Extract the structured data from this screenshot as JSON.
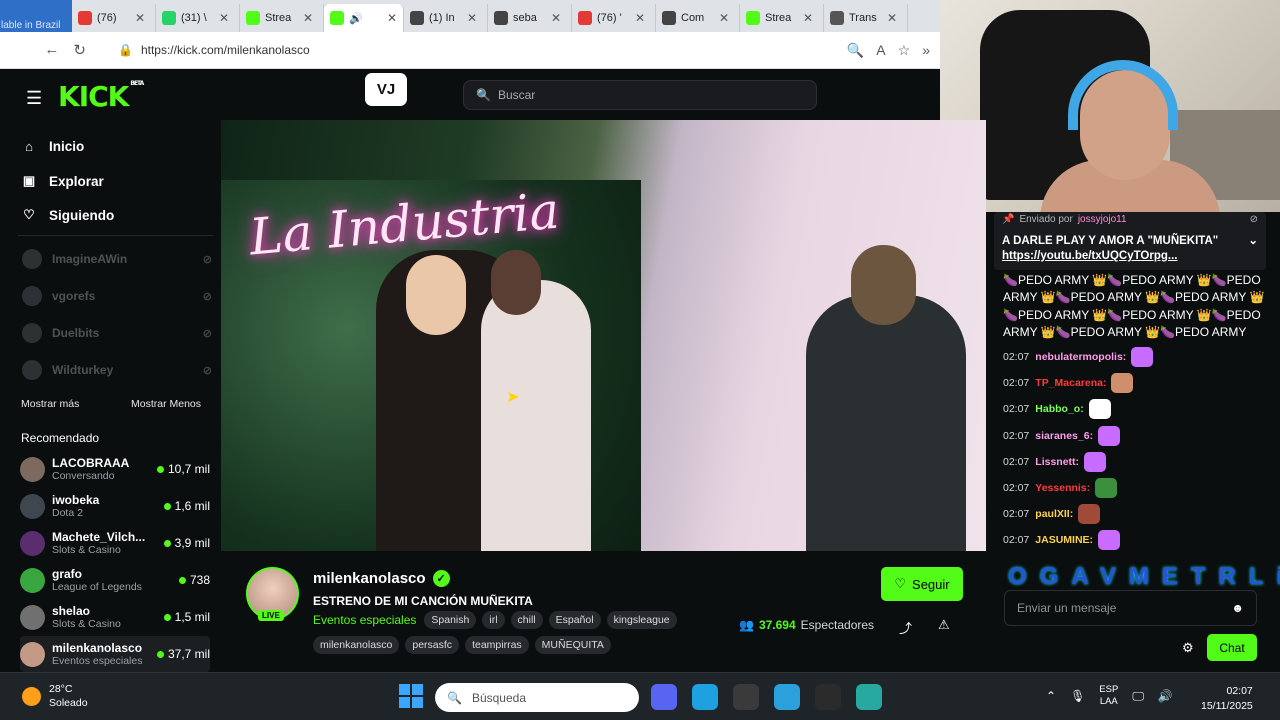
{
  "browser": {
    "lead_text": "lable in Brazil",
    "tabs": [
      {
        "label": "(76) ",
        "color": "#e53935"
      },
      {
        "label": "(31) \\",
        "color": "#25d366"
      },
      {
        "label": "Strea",
        "color": "#53fc18"
      },
      {
        "label": "",
        "color": "#53fc18",
        "active": true
      },
      {
        "label": "(1) In",
        "color": "#444444"
      },
      {
        "label": "seba",
        "color": "#444444"
      },
      {
        "label": "(76) '",
        "color": "#e53935"
      },
      {
        "label": "Com",
        "color": "#444444"
      },
      {
        "label": "Strea",
        "color": "#53fc18"
      },
      {
        "label": "Trans",
        "color": "#555555"
      }
    ],
    "url": "https://kick.com/milenkanolasco"
  },
  "header": {
    "logo": "KICK",
    "logo_beta": "BETA",
    "vj_label": "VJ",
    "search_placeholder": "Buscar"
  },
  "sidebar": {
    "nav": [
      {
        "label": "Inicio",
        "icon": "home-icon"
      },
      {
        "label": "Explorar",
        "icon": "compass-icon"
      },
      {
        "label": "Siguiendo",
        "icon": "heart-icon"
      }
    ],
    "followed": [
      "ImagineAWin",
      "vgorefs",
      "Duelbits",
      "Wildturkey"
    ],
    "show_more": "Mostrar más",
    "show_less": "Mostrar Menos",
    "recommended_title": "Recomendado",
    "recommended": [
      {
        "name": "LACOBRAAA",
        "category": "Conversando",
        "viewers": "10,7 mil",
        "color": "#7c6a5e"
      },
      {
        "name": "iwobeka",
        "category": "Dota 2",
        "viewers": "1,6 mil",
        "color": "#3e4650"
      },
      {
        "name": "Machete_Vilch...",
        "category": "Slots & Casino",
        "viewers": "3,9 mil",
        "color": "#5a2d6e"
      },
      {
        "name": "grafo",
        "category": "League of Legends",
        "viewers": "738",
        "color": "#3aa640"
      },
      {
        "name": "shelao",
        "category": "Slots & Casino",
        "viewers": "1,5 mil",
        "color": "#707070"
      },
      {
        "name": "milenkanolasco",
        "category": "Eventos especiales",
        "viewers": "37,7 mil",
        "color": "#c49a86",
        "selected": true
      }
    ]
  },
  "stream": {
    "neon_text": "La Industria",
    "streamer": "milenkanolasco",
    "live_label": "LIVE",
    "title": "ESTRENO DE MI CANCIÓN MUÑEKITA",
    "category": "Eventos especiales",
    "tags": [
      "Spanish",
      "irl",
      "chill",
      "Español",
      "kingsleague"
    ],
    "tags2": [
      "milenkanolasco",
      "persasfc",
      "teampirras",
      "MUÑEQUITA"
    ],
    "follow_label": "Seguir",
    "viewers_count": "37.694",
    "viewers_label": "Espectadores"
  },
  "chat": {
    "pinned_by_label": "Enviado por",
    "pinned_user": "jossyjojo11",
    "pinned_message": "A DARLE PLAY Y AMOR A \"MUÑEKITA\"",
    "pinned_link": "https://youtu.be/txUQCyTOrpg...",
    "spam_message": "🍆PEDO ARMY 👑🍆PEDO ARMY 👑🍆PEDO ARMY 👑🍆PEDO ARMY 👑🍆PEDO ARMY 👑🍆PEDO ARMY 👑🍆PEDO ARMY 👑🍆PEDO ARMY 👑🍆PEDO ARMY 👑🍆PEDO ARMY",
    "messages": [
      {
        "time": "02:07",
        "user": "nebulatermopolis:",
        "color": "#ff9ee8",
        "emote": "#c86cff"
      },
      {
        "time": "02:07",
        "user": "TP_Macarena:",
        "color": "#ff3b3b",
        "emote": "#d08f6c"
      },
      {
        "time": "02:07",
        "user": "Habbo_o:",
        "color": "#7cff5a",
        "emote": "#ffffff"
      },
      {
        "time": "02:07",
        "user": "siaranes_6:",
        "color": "#ff9ee8",
        "emote": "#c86cff"
      },
      {
        "time": "02:07",
        "user": "Lissnett:",
        "color": "#ff9ee8",
        "emote": "#c86cff"
      },
      {
        "time": "02:07",
        "user": "Yessennis:",
        "color": "#ff3b3b",
        "emote": "#3c8f3c"
      },
      {
        "time": "02:07",
        "user": "paulXII:",
        "color": "#ffd24a",
        "emote": "#a04a3a"
      },
      {
        "time": "02:07",
        "user": "JASUMINE:",
        "color": "#ffd24a",
        "emote": "#c86cff"
      }
    ],
    "banner_text": "OGAVMETRLi",
    "input_placeholder": "Enviar un mensaje",
    "send_label": "Chat"
  },
  "taskbar": {
    "temp": "28°C",
    "weather": "Soleado",
    "search_placeholder": "Búsqueda",
    "lang_top": "ESP",
    "lang_bottom": "LAA",
    "time": "02:07",
    "date": "15/11/2025",
    "apps": [
      {
        "icon": "discord-icon",
        "color": "#5865f2"
      },
      {
        "icon": "edge-icon",
        "color": "#1fa0e0"
      },
      {
        "icon": "obs-icon",
        "color": "#3a3a3a"
      },
      {
        "icon": "telegram-icon",
        "color": "#2aa1da"
      },
      {
        "icon": "calculator-icon",
        "color": "#2b2b2b"
      },
      {
        "icon": "edge-dev-icon",
        "color": "#27a9a0"
      }
    ]
  }
}
